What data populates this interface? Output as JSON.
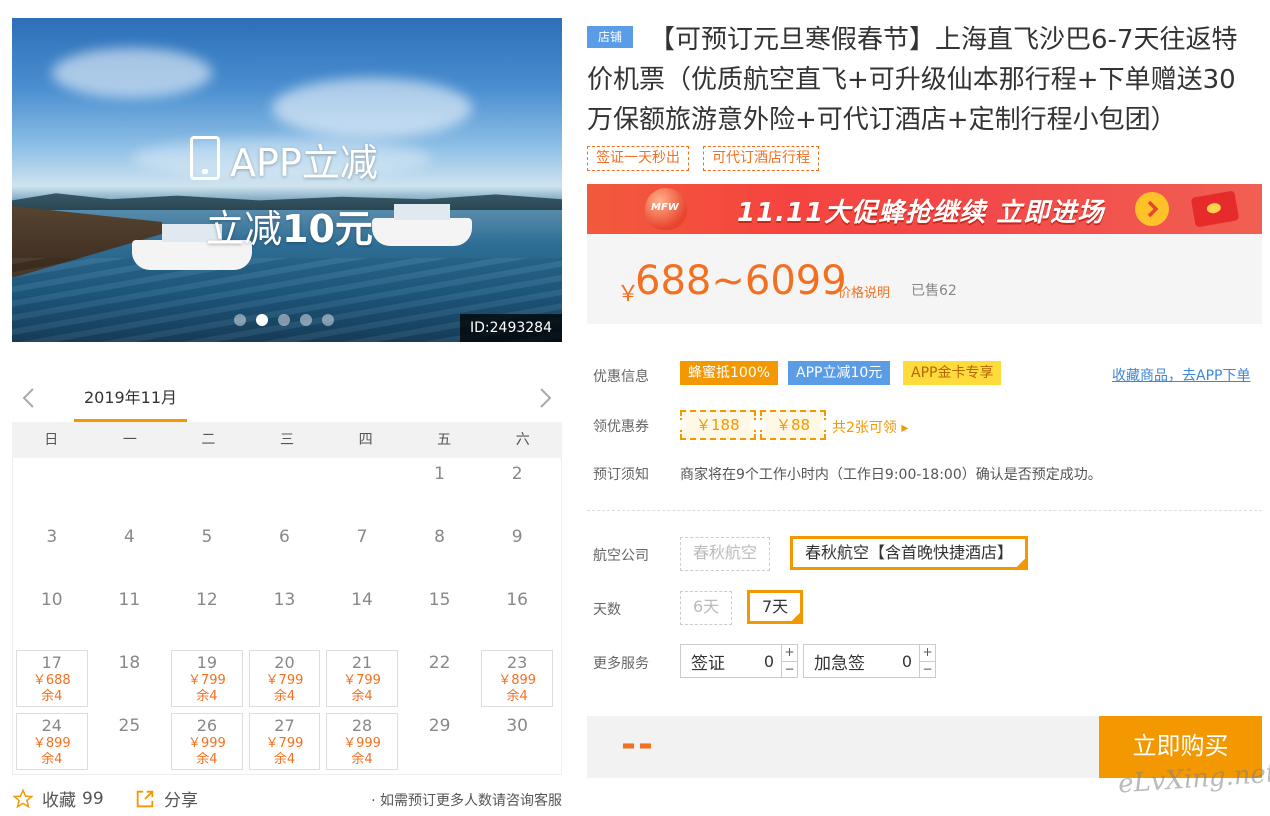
{
  "hero": {
    "title": "APP立减",
    "subtitle_prefix": "立减",
    "subtitle_amount": "10元",
    "id_label": "ID:2493284",
    "dots": 5,
    "active_dot": 2
  },
  "calendar": {
    "month": "2019年11月",
    "weekdays": [
      "日",
      "一",
      "二",
      "三",
      "四",
      "五",
      "六"
    ],
    "cells": [
      {
        "d": ""
      },
      {
        "d": ""
      },
      {
        "d": ""
      },
      {
        "d": ""
      },
      {
        "d": ""
      },
      {
        "d": "1"
      },
      {
        "d": "2"
      },
      {
        "d": "3"
      },
      {
        "d": "4"
      },
      {
        "d": "5"
      },
      {
        "d": "6"
      },
      {
        "d": "7"
      },
      {
        "d": "8"
      },
      {
        "d": "9"
      },
      {
        "d": "10"
      },
      {
        "d": "11"
      },
      {
        "d": "12"
      },
      {
        "d": "13"
      },
      {
        "d": "14"
      },
      {
        "d": "15"
      },
      {
        "d": "16"
      },
      {
        "d": "17",
        "p": "￥688",
        "r": "余4"
      },
      {
        "d": "18"
      },
      {
        "d": "19",
        "p": "￥799",
        "r": "余4"
      },
      {
        "d": "20",
        "p": "￥799",
        "r": "余4"
      },
      {
        "d": "21",
        "p": "￥799",
        "r": "余4"
      },
      {
        "d": "22"
      },
      {
        "d": "23",
        "p": "￥899",
        "r": "余4"
      },
      {
        "d": "24",
        "p": "￥899",
        "r": "余4"
      },
      {
        "d": "25"
      },
      {
        "d": "26",
        "p": "￥999",
        "r": "余4"
      },
      {
        "d": "27",
        "p": "￥799",
        "r": "余4"
      },
      {
        "d": "28",
        "p": "￥999",
        "r": "余4"
      },
      {
        "d": "29"
      },
      {
        "d": "30"
      }
    ]
  },
  "footer": {
    "favorite_label": "收藏",
    "favorite_count": "99",
    "share_label": "分享",
    "note": "· 如需预订更多人数请咨询客服"
  },
  "product": {
    "shop_tag": "店铺",
    "title": "【可预订元旦寒假春节】上海直飞沙巴6-7天往返特价机票（优质航空直飞+可升级仙本那行程+下单赠送30万保额旅游意外险+可代订酒店+定制行程小包团）",
    "badges": [
      "签证一天秒出",
      "可代订酒店行程"
    ],
    "promo_text": "11.11大促蜂抢继续 立即进场",
    "promo_logo": "MFW",
    "price_currency": "￥",
    "price_range": "688~6099",
    "price_explain": "价格说明",
    "sold": "已售62"
  },
  "offers": {
    "label": "优惠信息",
    "tags": [
      "蜂蜜抵100%",
      "APP立减10元",
      "APP金卡专享"
    ],
    "fav_link": "收藏商品，去APP下单"
  },
  "coupons": {
    "label": "领优惠券",
    "items": [
      "￥188",
      "￥88"
    ],
    "more": "共2张可领 ▸"
  },
  "notice": {
    "label": "预订须知",
    "text": "商家将在9个工作小时内（工作日9:00-18:00）确认是否预定成功。"
  },
  "airline": {
    "label": "航空公司",
    "options": [
      "春秋航空",
      "春秋航空【含首晚快捷酒店】"
    ],
    "selected_index": 1
  },
  "days": {
    "label": "天数",
    "options": [
      "6天",
      "7天"
    ],
    "selected_index": 1
  },
  "services": {
    "label": "更多服务",
    "items": [
      {
        "name": "签证",
        "value": "0",
        "plus": "+",
        "minus": "−"
      },
      {
        "name": "加急签",
        "value": "0",
        "plus": "+",
        "minus": "−"
      }
    ]
  },
  "buy": {
    "total": "--",
    "button": "立即购买"
  },
  "watermark": "eLvXing.net",
  "colors": {
    "accent": "#f39800",
    "price": "#f37021",
    "link": "#3f86d6",
    "app_blue": "#5b9ce6"
  }
}
